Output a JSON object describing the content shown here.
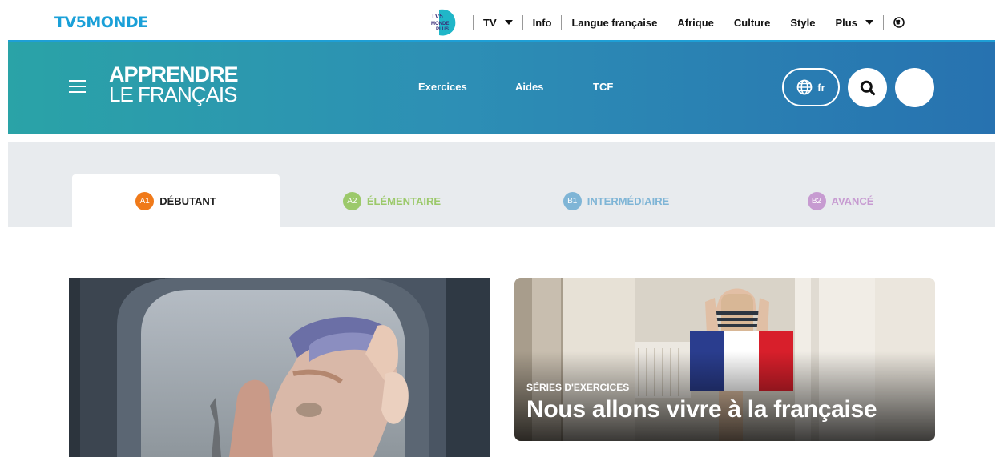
{
  "topbar": {
    "brand": "TV5MONDE",
    "tv5plus_label": "TV5 MONDE PLUS",
    "nav": [
      {
        "label": "TV",
        "dropdown": true
      },
      {
        "label": "Info"
      },
      {
        "label": "Langue française"
      },
      {
        "label": "Afrique"
      },
      {
        "label": "Culture"
      },
      {
        "label": "Style"
      },
      {
        "label": "Plus",
        "dropdown": true
      }
    ],
    "globe_icon": "globe-icon"
  },
  "header": {
    "logo_line1": "APPRENDRE",
    "logo_line2": "LE FRANÇAIS",
    "nav": [
      "Exercices",
      "Aides",
      "TCF"
    ],
    "language": "fr",
    "colors": {
      "gradient_start": "#2aa3a7",
      "gradient_end": "#2772b0"
    }
  },
  "levels": [
    {
      "code": "A1",
      "label": "DÉBUTANT",
      "color": "#f07a1a",
      "active": true
    },
    {
      "code": "A2",
      "label": "ÉLÉMENTAIRE",
      "color": "#9cc96b",
      "active": false
    },
    {
      "code": "B1",
      "label": "INTERMÉDIAIRE",
      "color": "#7fb5d6",
      "active": false
    },
    {
      "code": "B2",
      "label": "AVANCÉ",
      "color": "#c79bd1",
      "active": false
    }
  ],
  "cards": [
    {
      "category": "",
      "title": ""
    },
    {
      "category": "SÉRIES D'EXERCICES",
      "title": "Nous allons vivre à la française"
    }
  ]
}
